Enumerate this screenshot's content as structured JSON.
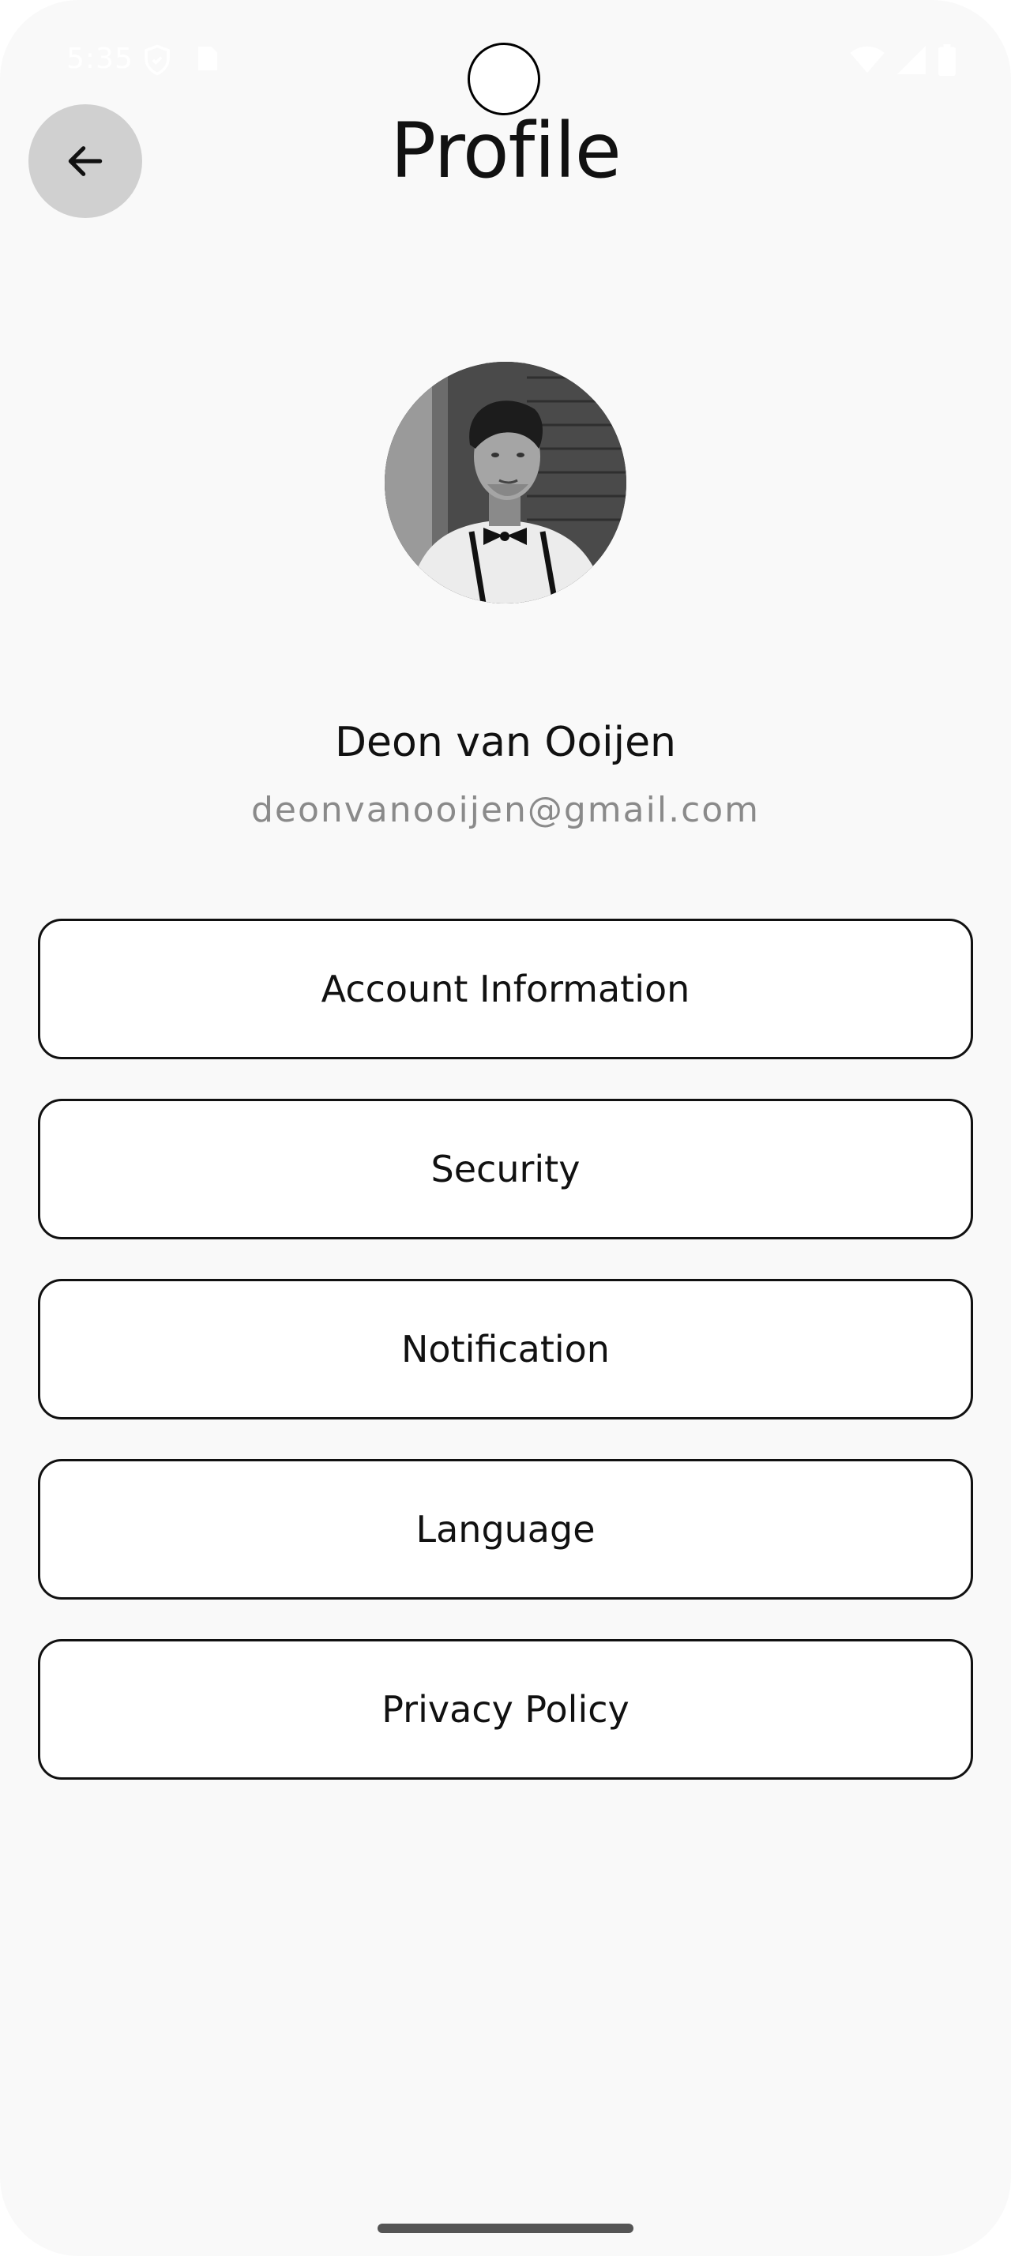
{
  "status_bar": {
    "time": "5:35",
    "icons_left": [
      "shield-icon",
      "sim-card-icon"
    ],
    "icons_right": [
      "wifi-icon",
      "signal-icon",
      "battery-icon"
    ]
  },
  "header": {
    "back_icon": "arrow-left-icon",
    "title": "Profile"
  },
  "profile": {
    "avatar": "user-photo",
    "name": "Deon van Ooijen",
    "email": "deonvanooijen@gmail.com"
  },
  "menu": {
    "items": [
      {
        "label": "Account Information"
      },
      {
        "label": "Security"
      },
      {
        "label": "Notification"
      },
      {
        "label": "Language"
      },
      {
        "label": "Privacy Policy"
      }
    ]
  },
  "colors": {
    "background": "#f9f9f9",
    "back_button_bg": "#d0d0d0",
    "text_primary": "#111111",
    "text_secondary": "#8a8a8a",
    "item_border": "#111111"
  }
}
